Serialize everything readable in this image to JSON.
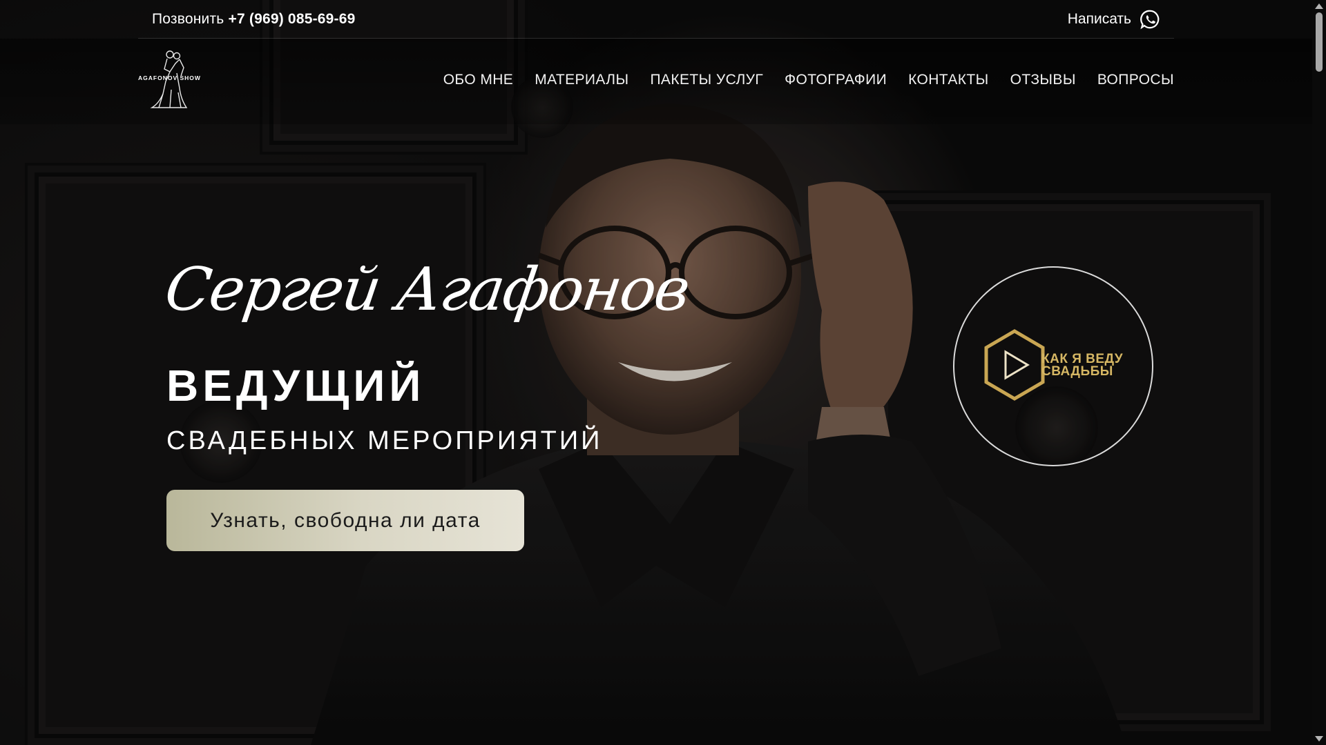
{
  "topbar": {
    "call_prefix": "Позвонить",
    "phone": "+7 (969) 085-69-69",
    "write_label": "Написать",
    "write_icon": "whatsapp-icon"
  },
  "logo": {
    "text": "AGAFONOV SHOW",
    "icon": "dancing-couple-icon"
  },
  "nav": {
    "items": [
      {
        "label": "ОБО МНЕ"
      },
      {
        "label": "МАТЕРИАЛЫ"
      },
      {
        "label": "ПАКЕТЫ УСЛУГ"
      },
      {
        "label": "ФОТОГРАФИИ"
      },
      {
        "label": "КОНТАКТЫ"
      },
      {
        "label": "ОТЗЫВЫ"
      },
      {
        "label": "ВОПРОСЫ"
      }
    ]
  },
  "hero": {
    "name": "Сергей Агафонов",
    "title": "ВЕДУЩИЙ",
    "subtitle": "СВАДЕБНЫХ МЕРОПРИЯТИЙ",
    "cta_label": "Узнать, свободна ли дата"
  },
  "video": {
    "label_line1": "КАК Я ВЕДУ",
    "label_line2": "СВАДЬБЫ",
    "icon": "hexagon-play-icon",
    "accent": "#d6b764"
  },
  "colors": {
    "background": "#0d0d0d",
    "text": "#ffffff",
    "cta_bg": "#d9d6c4",
    "cta_text": "#1b1b1b",
    "gold": "#d6b764"
  }
}
